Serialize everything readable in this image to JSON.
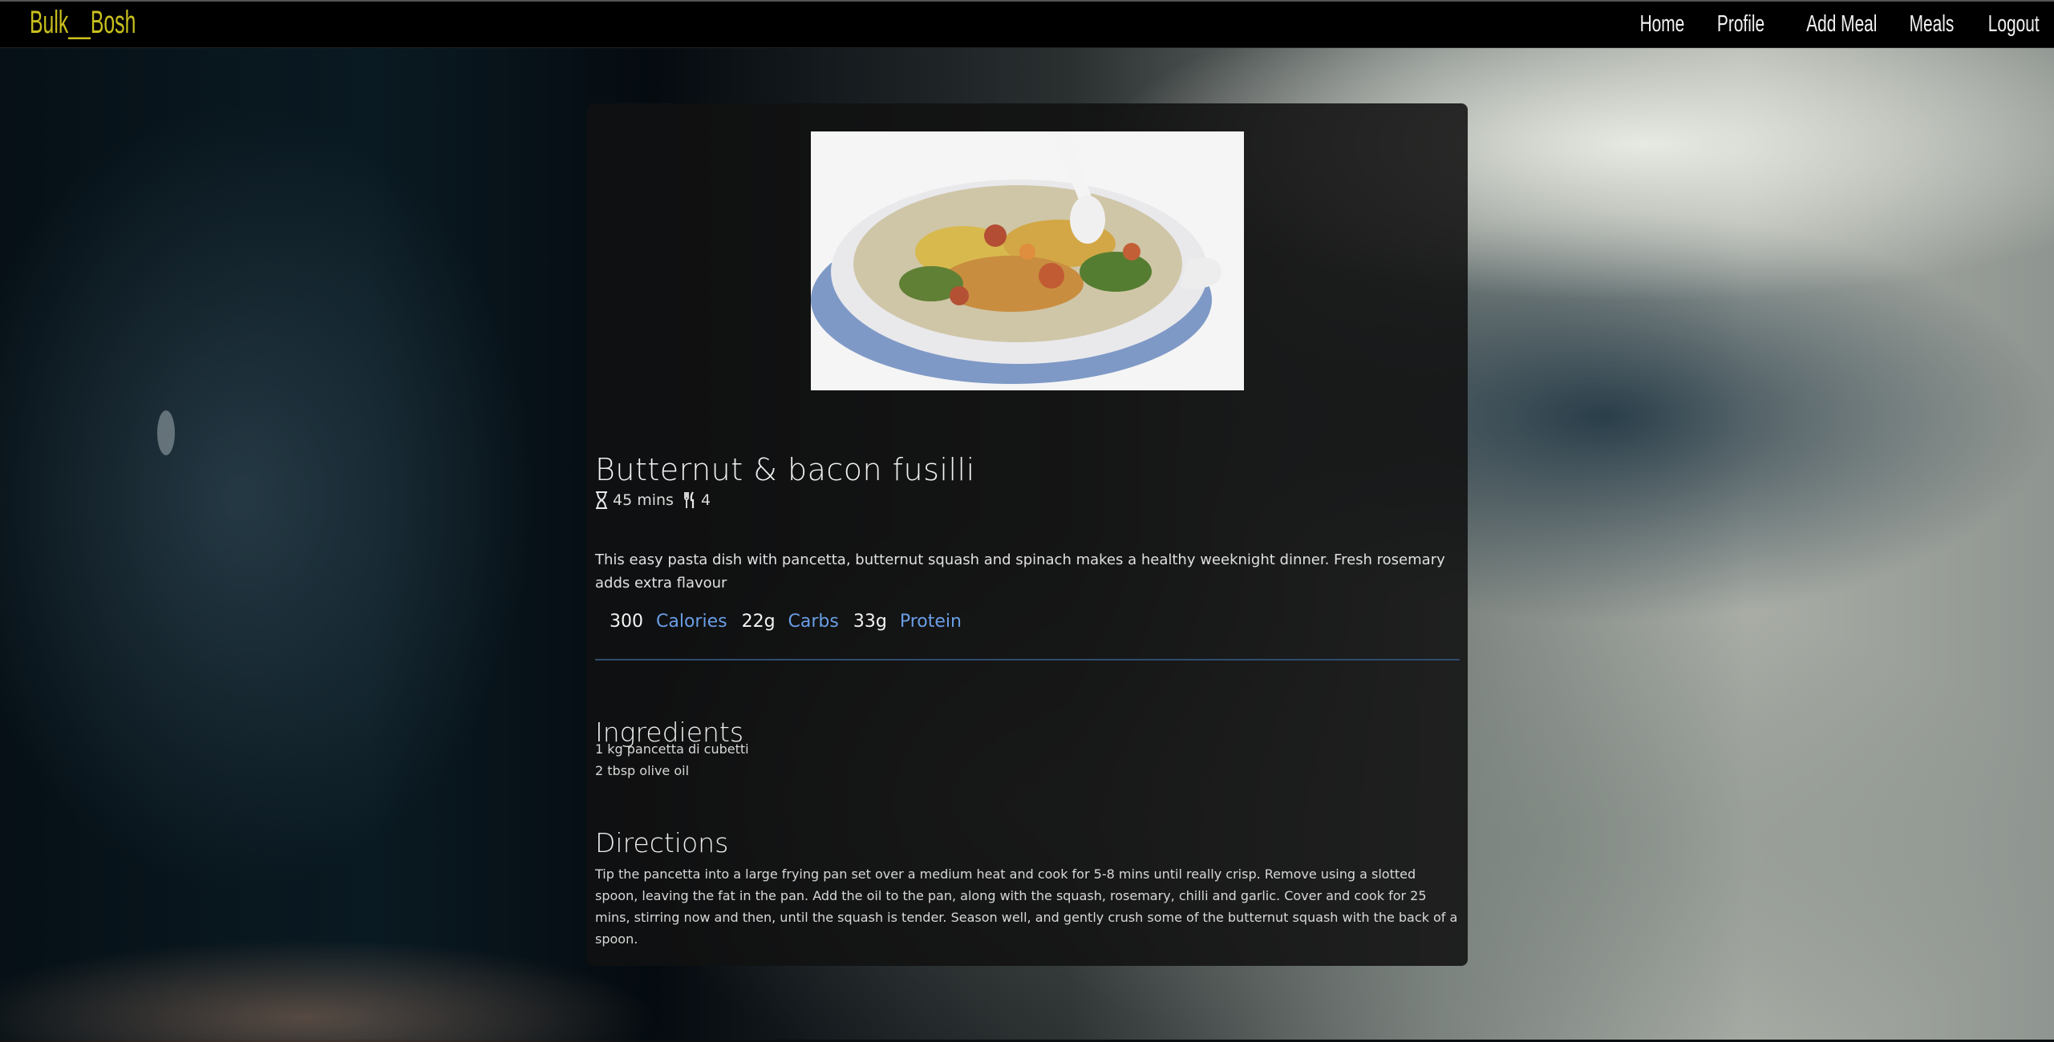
{
  "navbar": {
    "brand": "Bulk__Bosh",
    "links": [
      "Home",
      "Profile",
      "Add Meal",
      "Meals",
      "Logout"
    ]
  },
  "meal": {
    "title": "Butternut & bacon fusilli",
    "time": "45 mins",
    "servings": "4",
    "description": "This easy pasta dish with pancetta, butternut squash and spinach makes a healthy weeknight dinner. Fresh rosemary adds extra flavour",
    "macros": [
      {
        "value": "300",
        "label": "Calories"
      },
      {
        "value": "22g",
        "label": "Carbs"
      },
      {
        "value": "33g",
        "label": "Protein"
      }
    ],
    "ingredients_heading": "Ingredients",
    "ingredients": [
      "1 kg pancetta di cubetti",
      "2 tbsp olive oil"
    ],
    "directions_heading": "Directions",
    "directions": "Tip the pancetta into a large frying pan set over a medium heat and cook for 5-8 mins until really crisp. Remove using a slotted spoon, leaving the fat in the pan. Add the oil to the pan, along with the squash, rosemary, chilli and garlic. Cover and cook for 25 mins, stirring now and then, until the squash is tender. Season well, and gently crush some of the butternut squash with the back of a spoon."
  },
  "icons": {
    "time": "hourglass-icon",
    "servings": "cutlery-icon"
  },
  "colors": {
    "brand": "#c9c01e",
    "macro_label": "#6a9ee6",
    "divider": "#2f4c6f"
  }
}
